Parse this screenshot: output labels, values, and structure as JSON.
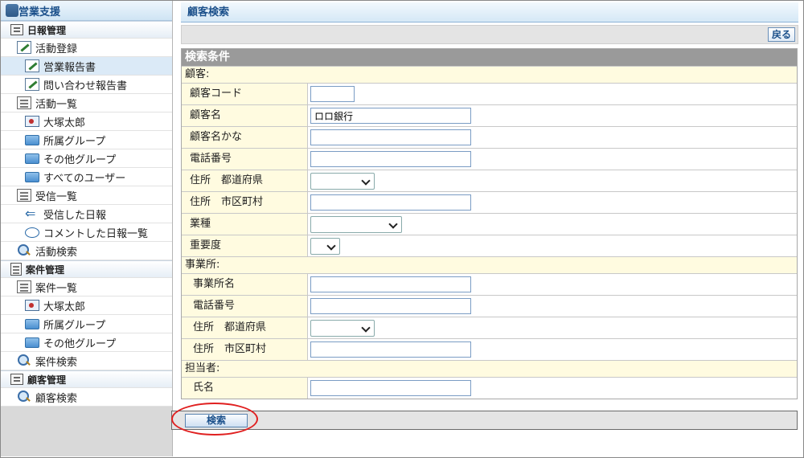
{
  "sidebar": {
    "app_title": "営業支援",
    "items": [
      {
        "label": "日報管理",
        "type": "section",
        "icon": "diary-book-icon"
      },
      {
        "label": "活動登録",
        "type": "lvl1",
        "icon": "edit-pen-icon"
      },
      {
        "label": "営業報告書",
        "type": "lvl2",
        "icon": "edit-pen-icon",
        "active": true
      },
      {
        "label": "問い合わせ報告書",
        "type": "lvl2",
        "icon": "edit-pen-icon"
      },
      {
        "label": "活動一覧",
        "type": "lvl1",
        "icon": "list-icon"
      },
      {
        "label": "大塚太郎",
        "type": "lvl2",
        "icon": "person-icon"
      },
      {
        "label": "所属グループ",
        "type": "lvl2",
        "icon": "folder-icon"
      },
      {
        "label": "その他グループ",
        "type": "lvl2",
        "icon": "folder-icon"
      },
      {
        "label": "すべてのユーザー",
        "type": "lvl2",
        "icon": "folder-icon"
      },
      {
        "label": "受信一覧",
        "type": "lvl1",
        "icon": "inbox-icon"
      },
      {
        "label": "受信した日報",
        "type": "lvl2",
        "icon": "receive-arrow-icon"
      },
      {
        "label": "コメントした日報一覧",
        "type": "lvl2",
        "icon": "comment-icon"
      },
      {
        "label": "活動検索",
        "type": "lvl1",
        "icon": "search-icon"
      },
      {
        "label": "案件管理",
        "type": "section",
        "icon": "project-doc-icon"
      },
      {
        "label": "案件一覧",
        "type": "lvl1",
        "icon": "list-icon"
      },
      {
        "label": "大塚太郎",
        "type": "lvl2",
        "icon": "person-icon"
      },
      {
        "label": "所属グループ",
        "type": "lvl2",
        "icon": "folder-icon"
      },
      {
        "label": "その他グループ",
        "type": "lvl2",
        "icon": "folder-icon"
      },
      {
        "label": "案件検索",
        "type": "lvl1",
        "icon": "search-icon"
      },
      {
        "label": "顧客管理",
        "type": "section",
        "icon": "customer-card-icon"
      },
      {
        "label": "顧客検索",
        "type": "lvl1",
        "icon": "search-icon"
      }
    ]
  },
  "main": {
    "page_title": "顧客検索",
    "back_label": "戻る",
    "form_title": "検索条件",
    "groups": {
      "customer": "顧客:",
      "office": "事業所:",
      "person": "担当者:"
    },
    "fields": {
      "customer_code": {
        "label": "顧客コード",
        "value": ""
      },
      "customer_name": {
        "label": "顧客名",
        "value": "ロロ銀行"
      },
      "customer_kana": {
        "label": "顧客名かな",
        "value": ""
      },
      "phone": {
        "label": "電話番号",
        "value": ""
      },
      "prefecture": {
        "label": "住所　都道府県",
        "value": ""
      },
      "city": {
        "label": "住所　市区町村",
        "value": ""
      },
      "industry": {
        "label": "業種",
        "value": ""
      },
      "importance": {
        "label": "重要度",
        "value": ""
      },
      "office_name": {
        "label": "事業所名",
        "value": ""
      },
      "office_phone": {
        "label": "電話番号",
        "value": ""
      },
      "office_prefecture": {
        "label": "住所　都道府県",
        "value": ""
      },
      "office_city": {
        "label": "住所　市区町村",
        "value": ""
      },
      "person_name": {
        "label": "氏名",
        "value": ""
      }
    },
    "search_label": "検索"
  },
  "colors": {
    "accent": "#1a4f8a",
    "label_bg": "#fffbe0",
    "header_bg": "#9a9a9a",
    "highlight": "#e02020"
  }
}
